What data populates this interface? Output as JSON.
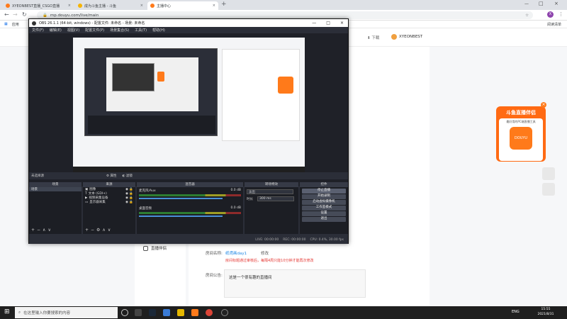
{
  "browser": {
    "tabs": [
      {
        "label": "XYEONBEST直播_CSGO直播",
        "color": "#ff7a1a"
      },
      {
        "label": "成为斗鱼主播 - 斗鱼",
        "color": "#f6b400"
      },
      {
        "label": "主播中心",
        "color": "#ff7a1a"
      }
    ],
    "new_tab": "+",
    "url": "mp.douyu.com/live/main",
    "bookmarks": [
      "应用",
      "阅读清单"
    ],
    "profile_letter": "X"
  },
  "site": {
    "download_label": "下载",
    "username": "XYEONBEST",
    "sidebar_item": "直播伴侣",
    "room_name_label": "房间名称:",
    "room_name_value": "纸鸢画day1",
    "room_name_edit": "修改",
    "room_name_warning": "房间标题通过审核后，每隔4周只能10分钟才能再次修改",
    "room_notice_label": "房间公告:",
    "room_notice_value": "这是一个很有趣的直播间",
    "ad_title": "斗鱼直播伴侣",
    "ad_subtitle": "最好用的PC端直播工具",
    "ad_logo": "DOUYU",
    "ad_close": "×"
  },
  "obs": {
    "title": "OBS 26.1.1 (64-bit, windows) - 配置文件: 未命名 - 场景: 未命名",
    "menu": [
      "文件(F)",
      "编辑(E)",
      "视图(V)",
      "配置文件(P)",
      "场景集合(S)",
      "工具(T)",
      "帮助(H)"
    ],
    "no_source": "未选择源",
    "props": "属性",
    "filters": "滤镜",
    "docks": {
      "scenes": "场景",
      "sources": "来源",
      "mixer": "混音器",
      "transitions": "转场特效",
      "controls": "控件"
    },
    "scene_item": "场景",
    "sources": [
      "图像",
      "文本 (GDI+)",
      "视频采集设备",
      "显示器采集"
    ],
    "mixer": [
      {
        "name": "麦克风/Aux",
        "db": "0.0 dB"
      },
      {
        "name": "桌面音频",
        "db": "0.0 dB"
      }
    ],
    "transition": {
      "type": "淡出",
      "duration_label": "时长",
      "duration": "300 ms"
    },
    "controls": [
      "停止直播",
      "开始录制",
      "启动虚拟摄像机",
      "工作室模式",
      "设置",
      "退出"
    ],
    "status": {
      "live": "LIVE: 00:00:00",
      "rec": "REC: 00:00:00",
      "cpu": "CPU: 0.4%, 30.00 fps"
    }
  },
  "taskbar": {
    "search_placeholder": "在这里输入你要搜索的内容",
    "ime": "ENG",
    "time": "15:55",
    "date": "2021/8/31"
  }
}
